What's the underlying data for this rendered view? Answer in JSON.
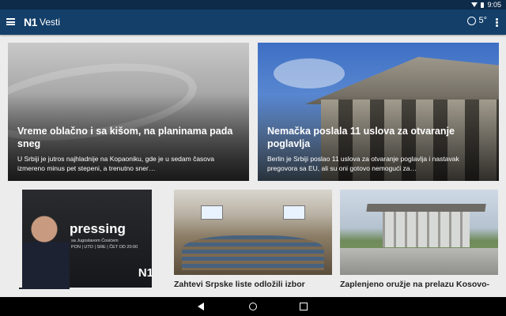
{
  "status_bar": {
    "time": "9:05",
    "icons": [
      "wifi-icon",
      "battery-icon"
    ]
  },
  "app_bar": {
    "menu_icon": "menu-icon",
    "logo": "N1",
    "title": "Vesti",
    "weather": {
      "icon": "cloud-moon-icon",
      "temperature": "5°"
    },
    "overflow_icon": "more-vert-icon"
  },
  "hero_cards": [
    {
      "title": "Vreme oblačno i sa kišom, na planinama pada sneg",
      "summary": "U Srbiji je jutros najhladnije na Kopaoniku, gde je u sedam časova izmereno minus pet stepeni, a trenutno snег…"
    },
    {
      "title": "Nemačka poslala 11 uslova za otvaranje poglavlja",
      "summary": "Berlin je Srbiji poslao 11 uslova za otvaranje poglavlja i nastavak pregovora sa EU, ali su oni gotovo nemogući za…"
    }
  ],
  "small_cards": [
    {
      "image_label": {
        "show": "pressing",
        "subtitle": "sa Jugoslavom Ćosićem",
        "schedule": "PON | UTO | SRE | ČET OD 20:00",
        "logo": "N1"
      },
      "caption": ""
    },
    {
      "caption": "Zahtevi Srpske liste odložili izbor"
    },
    {
      "caption": "Zaplenjeno oružje na prelazu Kosovo-"
    }
  ],
  "nav_bar": {
    "icons": [
      "back-icon",
      "home-icon",
      "recents-icon"
    ]
  },
  "colors": {
    "status_bar": "#0e2b4a",
    "app_bar": "#133f69",
    "background": "#ececec"
  }
}
